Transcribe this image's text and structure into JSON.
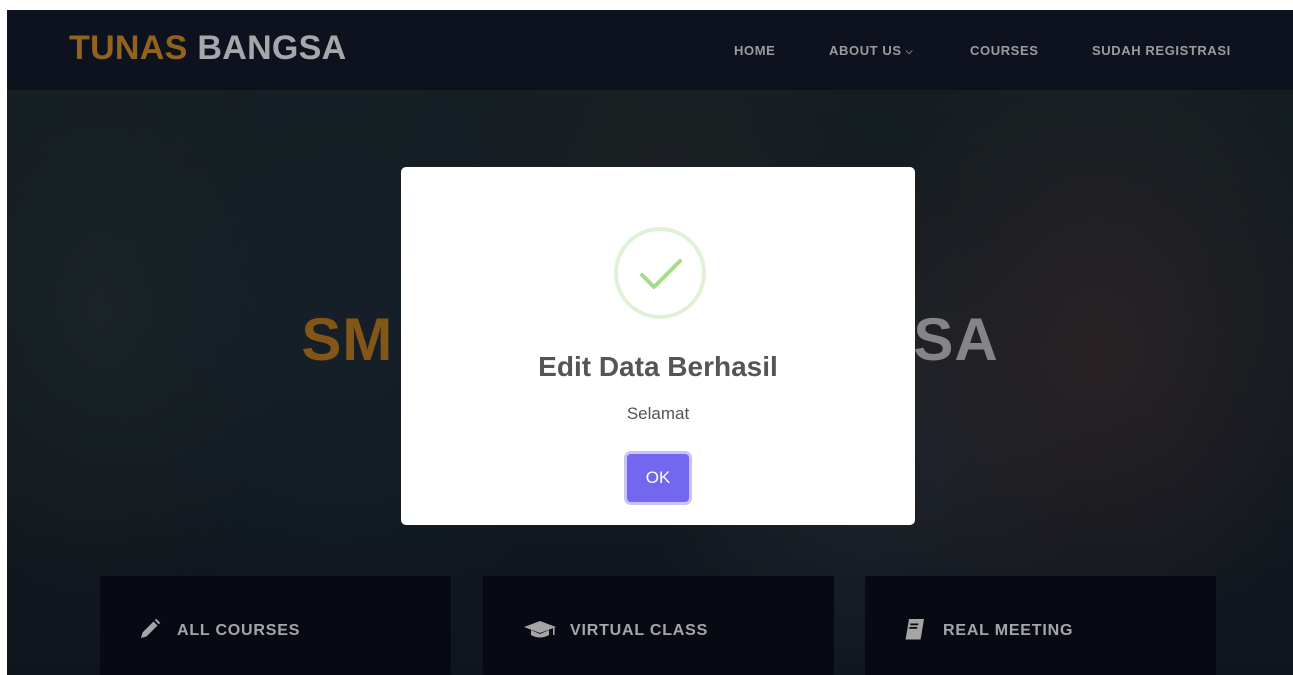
{
  "brand": {
    "part1": "TUNAS",
    "part2": "BANGSA",
    "accent": "#c9892a"
  },
  "nav": {
    "items": [
      {
        "label": "HOME"
      },
      {
        "label": "ABOUT US",
        "icon": "chevron-down-icon"
      },
      {
        "label": "COURSES"
      },
      {
        "label": "SUDAH REGISTRASI"
      }
    ]
  },
  "hero": {
    "title_visible_left": "SM",
    "title_visible_right": "SA",
    "accent": "#b8781f"
  },
  "features": [
    {
      "label": "ALL COURSES",
      "icon": "pencil-icon"
    },
    {
      "label": "VIRTUAL CLASS",
      "icon": "graduation-cap-icon"
    },
    {
      "label": "REAL MEETING",
      "icon": "book-icon"
    }
  ],
  "modal": {
    "icon": "check-icon",
    "title": "Edit Data Berhasil",
    "text": "Selamat",
    "ok_label": "OK",
    "button_color": "#7367f0",
    "check_color": "#a5dc86"
  }
}
